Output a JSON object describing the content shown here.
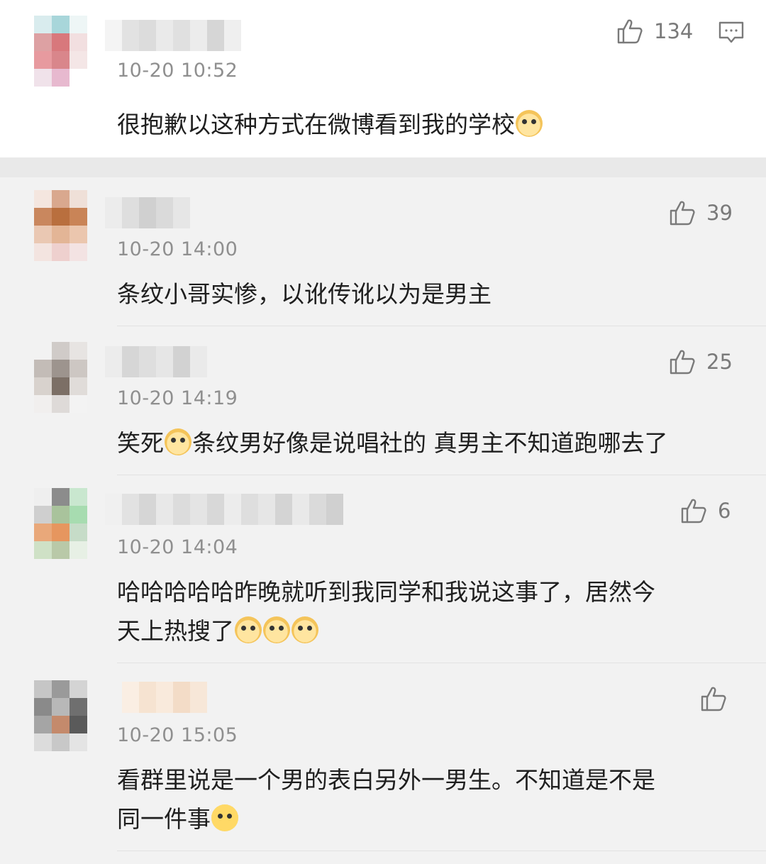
{
  "top_comment": {
    "timestamp": "10-20 10:52",
    "text_lines": [
      "很抱歉以这种方式在微博看到我的学校"
    ],
    "emoji": "doge-emoji",
    "likes": "134"
  },
  "replies": [
    {
      "timestamp": "10-20 14:00",
      "text_lines": [
        "条纹小哥实惨，以讹传讹以为是男主"
      ],
      "likes": "39"
    },
    {
      "timestamp": "10-20 14:19",
      "text_lines": [
        "笑死",
        "条纹男好像是说唱社的 真男主不知道跑哪去了"
      ],
      "likes": "25"
    },
    {
      "timestamp": "10-20 14:04",
      "text_lines": [
        "哈哈哈哈哈昨晚就听到我同学和我说这事了，居然今",
        "天上热搜了"
      ],
      "likes": "6"
    },
    {
      "timestamp": "10-20 15:05",
      "text_lines": [
        "看群里说是一个男的表白另外一男生。不知道是不是",
        "同一件事"
      ],
      "likes": ""
    }
  ],
  "colors": {
    "background": "#f2f2f2",
    "card": "#ffffff",
    "muted_text": "#8f8f8f",
    "icon_gray": "#7a7a7a"
  }
}
